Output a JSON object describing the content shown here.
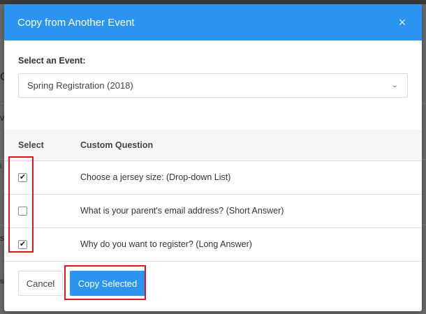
{
  "modal": {
    "title": "Copy from Another Event",
    "close_glyph": "×"
  },
  "event_picker": {
    "label": "Select an Event:",
    "selected": "Spring Registration (2018)",
    "chevron_icon": "chevron-down-icon"
  },
  "table": {
    "headers": {
      "select": "Select",
      "question": "Custom Question"
    },
    "rows": [
      {
        "question": "Choose a jersey size: (Drop-down List)",
        "checked": true
      },
      {
        "question": "What is your parent's email address? (Short Answer)",
        "checked": false
      },
      {
        "question": "Why do you want to register? (Long Answer)",
        "checked": true
      }
    ]
  },
  "footer": {
    "cancel_label": "Cancel",
    "copy_label": "Copy Selected"
  },
  "background_fragments": [
    "C",
    "v",
    "i",
    "s",
    "sh"
  ],
  "colors": {
    "accent": "#2b93f0",
    "highlight": "#e0141e"
  }
}
